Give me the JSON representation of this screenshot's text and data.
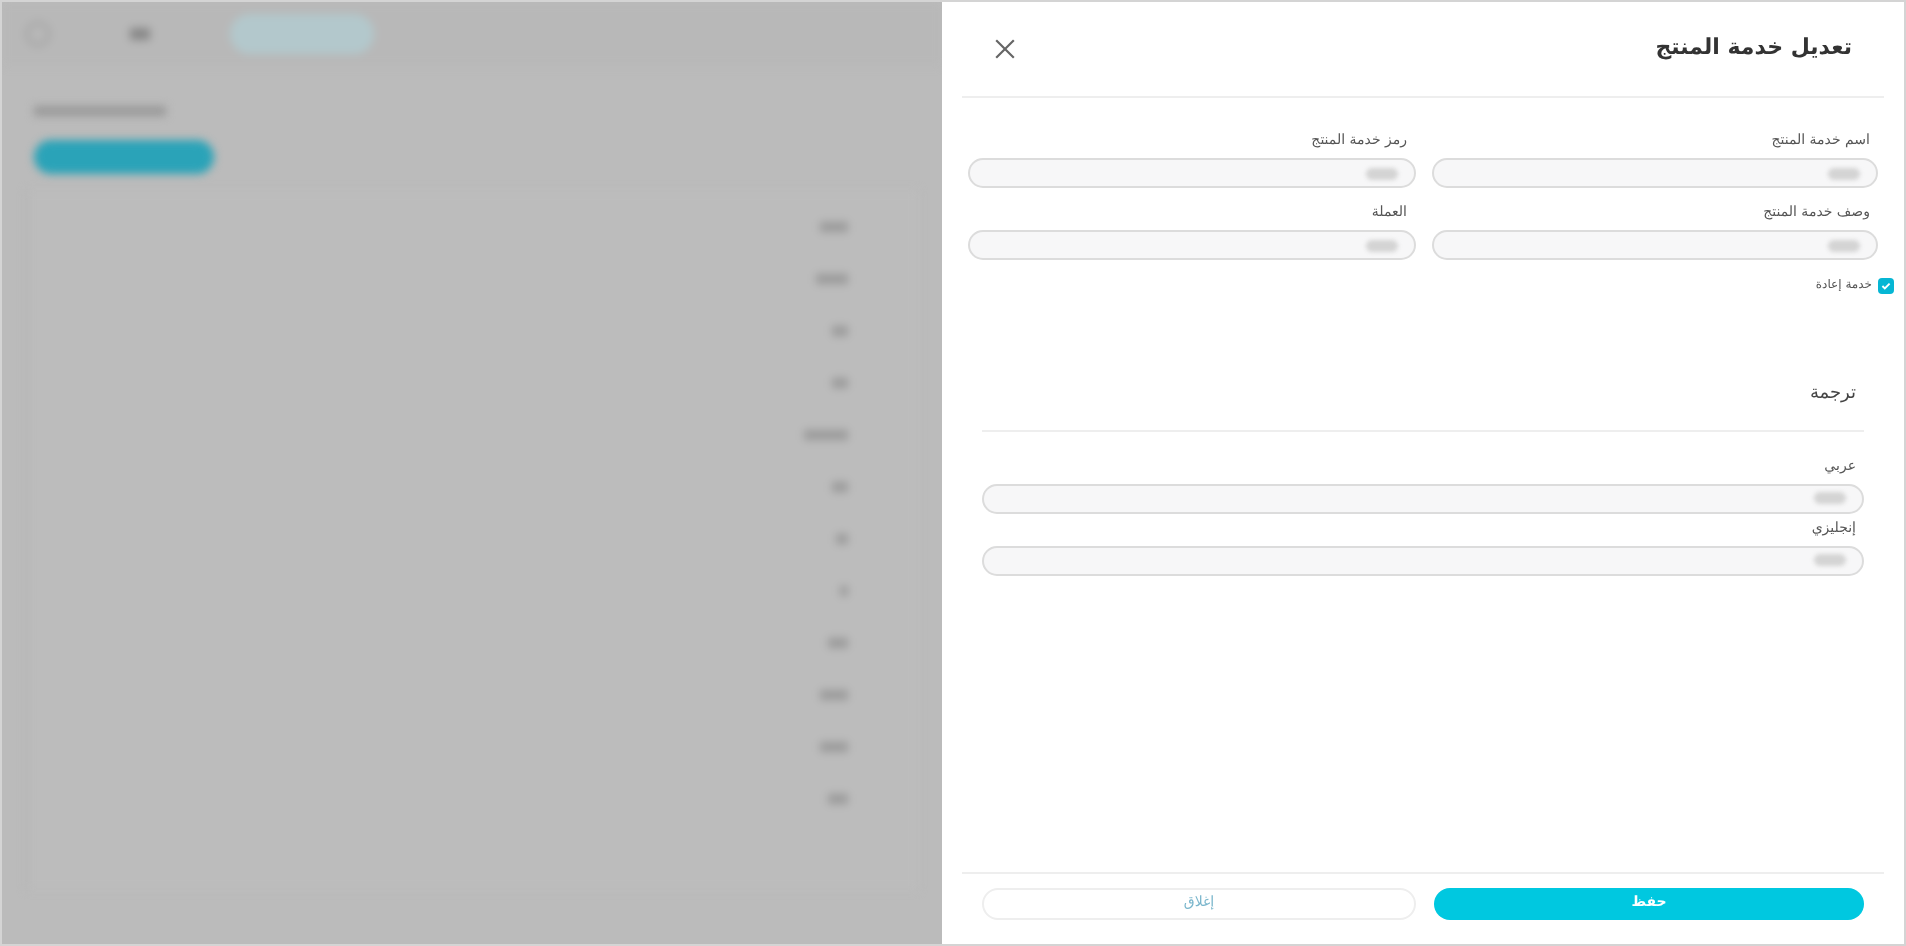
{
  "background": {
    "kind": "blurred"
  },
  "panel": {
    "title": "تعديل خدمة المنتج",
    "fields": [
      {
        "label": "اسم خدمة المنتج",
        "blurred": true
      },
      {
        "label": "رمز خدمة المنتج",
        "blurred": true
      },
      {
        "label": "وصف خدمة المنتج",
        "blurred": true
      },
      {
        "label": "العملة",
        "blurred": true
      }
    ],
    "checkbox": {
      "label": "خدمة إعادة",
      "checked": true
    },
    "translation": {
      "title": "ترجمة",
      "fields": [
        {
          "label": "عربي",
          "blurred": true
        },
        {
          "label": "إنجليزي",
          "blurred": true
        }
      ]
    },
    "buttons": [
      {
        "label": "حفظ",
        "kind": "primary"
      },
      {
        "label": "إغلاق",
        "kind": "secondary"
      }
    ]
  }
}
